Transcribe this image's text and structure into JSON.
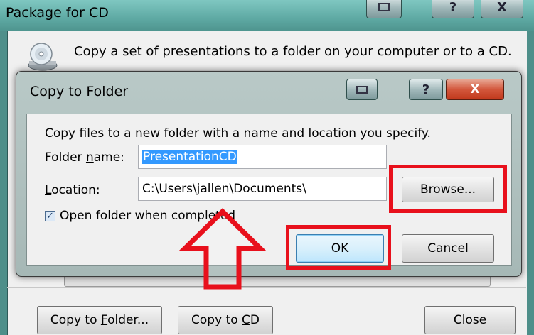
{
  "outer_dialog": {
    "title": "Package for CD",
    "message": "Copy a set of presentations to a folder on your computer or to a CD.",
    "buttons": {
      "copy_to_folder": {
        "pre": "Copy to ",
        "accel": "F",
        "post": "older..."
      },
      "copy_to_cd": {
        "pre": "Copy to ",
        "accel": "C",
        "post": "D"
      },
      "close": "Close"
    },
    "caption_buttons": {
      "help": "?",
      "close": "X"
    }
  },
  "inner_dialog": {
    "title": "Copy to Folder",
    "instruction": "Copy files to a new folder with a name and location you specify.",
    "folder_name": {
      "label_pre": "Folder ",
      "label_accel": "n",
      "label_post": "ame:",
      "value": "PresentationCD"
    },
    "location": {
      "label_pre": "",
      "label_accel": "L",
      "label_post": "ocation:",
      "value": "C:\\Users\\jallen\\Documents\\"
    },
    "browse": {
      "pre": "",
      "accel": "B",
      "post": "rowse..."
    },
    "open_folder_checkbox": {
      "label": "Open folder when completed",
      "checked": true
    },
    "ok": "OK",
    "cancel": "Cancel",
    "caption_buttons": {
      "help": "?",
      "close": "X"
    }
  },
  "annotations": {
    "highlight_color": "#e8101c",
    "highlighted": [
      "browse-button",
      "ok-button"
    ],
    "arrow_points_to": "ok-button"
  }
}
